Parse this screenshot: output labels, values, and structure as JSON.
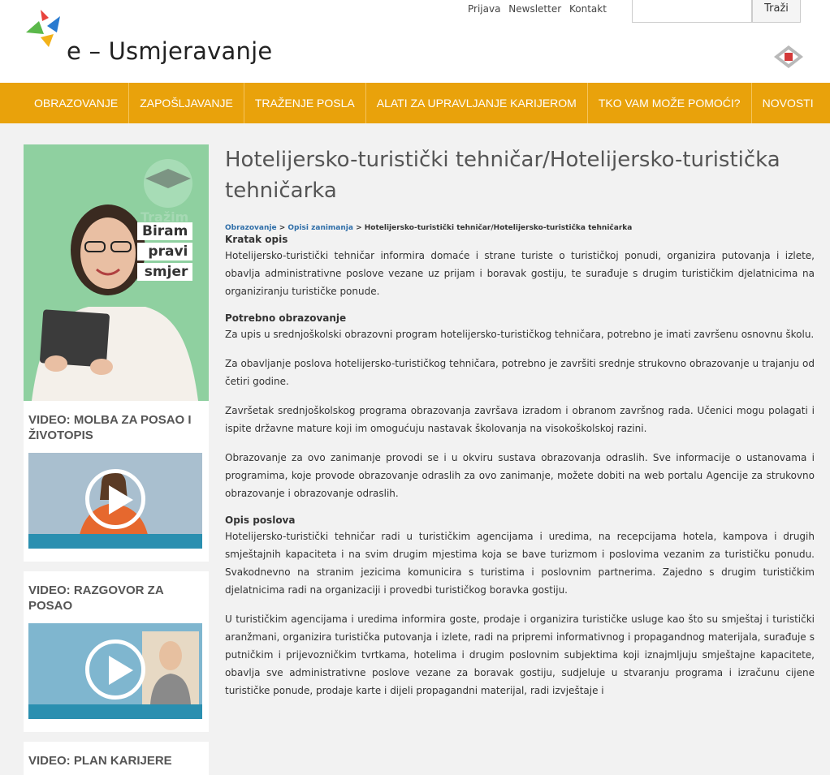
{
  "header": {
    "logo_text": "e – Usmjeravanje",
    "top_links": [
      "Prijava",
      "Newsletter",
      "Kontakt"
    ],
    "search_button": "Traži",
    "search_placeholder": ""
  },
  "nav": {
    "items": [
      "OBRAZOVANJE",
      "ZAPOŠLJAVANJE",
      "TRAŽENJE POSLA",
      "ALATI ZA UPRAVLJANJE KARIJEROM",
      "TKO VAM MOŽE POMOĆI?",
      "NOVOSTI"
    ]
  },
  "sidebar": {
    "banner_words": [
      "Tražim",
      "Biram",
      "pravi",
      "smjer"
    ],
    "videos": [
      {
        "title": "VIDEO: MOLBA ZA POSAO I ŽIVOTOPIS"
      },
      {
        "title": "VIDEO: RAZGOVOR ZA POSAO"
      },
      {
        "title": "VIDEO: PLAN KARIJERE"
      }
    ]
  },
  "main": {
    "title": "Hotelijersko-turistički tehničar/Hotelijersko-turistička tehničarka",
    "breadcrumb": {
      "item1": "Obrazovanje",
      "sep": " > ",
      "item2": "Opisi zanimanja",
      "current": "Hotelijersko-turistički tehničar/Hotelijersko-turistička tehničarka"
    },
    "sections": {
      "kratak_opis_title": "Kratak opis",
      "kratak_opis_text": "Hotelijersko-turistički tehničar informira domaće i strane turiste o turističkoj ponudi, organizira putovanja i izlete, obavlja administrativne poslove vezane uz prijam i boravak gostiju, te surađuje s drugim turističkim djelatnicima na organiziranju turističke ponude.",
      "obrazovanje_title": "Potrebno obrazovanje",
      "obrazovanje_p1": "Za upis u srednjoškolski obrazovni program hotelijersko-turističkog tehničara, potrebno je imati završenu osnovnu školu.",
      "obrazovanje_p2": "Za obavljanje poslova hotelijersko-turističkog tehničara, potrebno je završiti srednje strukovno obrazovanje u trajanju od četiri godine.",
      "obrazovanje_p3": "Završetak srednjoškolskog programa obrazovanja završava izradom i obranom završnog rada. Učenici mogu polagati i ispite državne mature koji im omogućuju nastavak školovanja na visokoškolskoj razini.",
      "obrazovanje_p4": "Obrazovanje za ovo zanimanje provodi se i u okviru sustava obrazovanja odraslih. Sve informacije o ustanovama i programima, koje provode obrazovanje odraslih za ovo zanimanje, možete dobiti na web portalu Agencije za strukovno obrazovanje i obrazovanje odraslih.",
      "opis_title": "Opis poslova",
      "opis_p1": "Hotelijersko-turistički tehničar radi u turističkim agencijama i uredima, na recepcijama hotela, kampova i drugih smještajnih kapaciteta i na svim drugim mjestima koja se bave turizmom i poslovima vezanim za turističku ponudu. Svakodnevno na stranim jezicima komunicira s turistima i poslovnim partnerima. Zajedno s drugim turističkim djelatnicima radi na organizaciji i provedbi turističkog boravka gostiju.",
      "opis_p2": "U turističkim agencijama i uredima informira goste, prodaje i organizira turističke usluge kao što su smještaj i turistički aranžmani, organizira turistička putovanja i izlete, radi na pripremi informativnog i propagandnog materijala, surađuje s putničkim i prijevozničkim tvrtkama, hotelima i drugim poslovnim subjektima koji iznajmljuju smještajne kapacitete, obavlja sve administrativne poslove vezane za boravak gostiju, sudjeluje u stvaranju programa i izračunu cijene turističke ponude, prodaje karte i dijeli propagandni materijal, radi izvještaje i"
    }
  },
  "colors": {
    "nav_bg": "#e9a20b",
    "link": "#2f6ea8",
    "banner_bg": "#7fc893"
  }
}
